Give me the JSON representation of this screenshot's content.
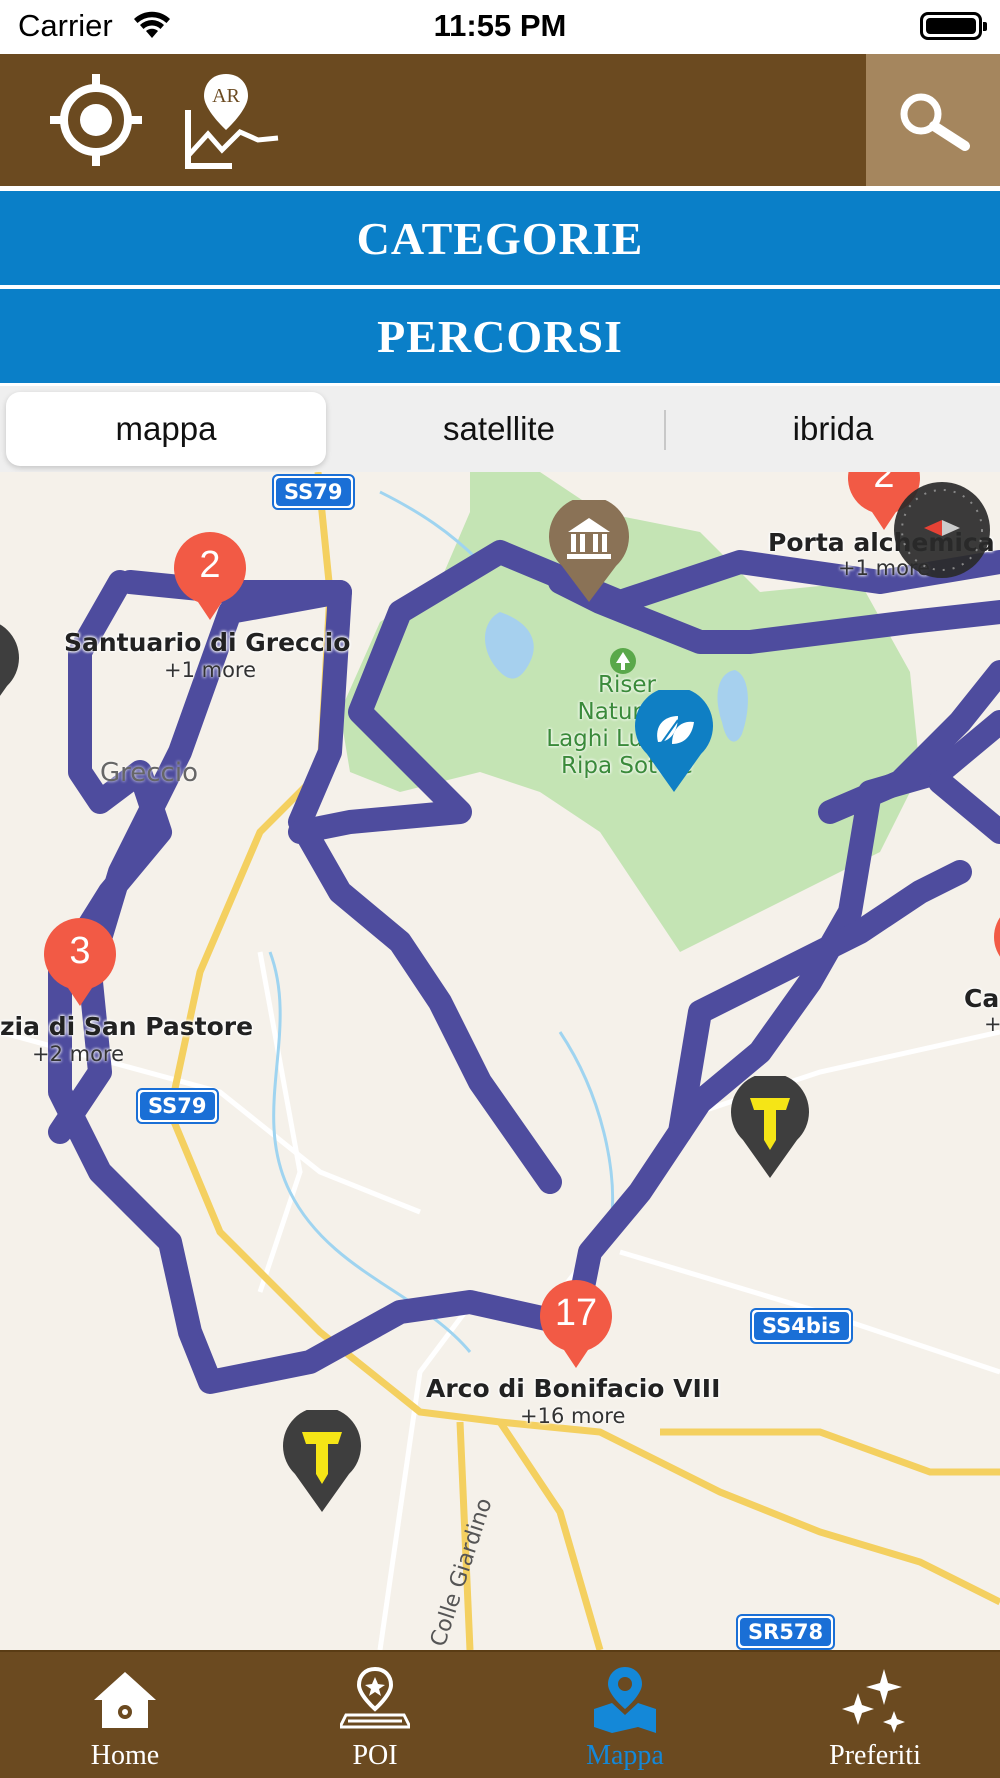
{
  "status_bar": {
    "carrier": "Carrier",
    "time": "11:55 PM"
  },
  "toolbar": {
    "ar_icon_text": "AR"
  },
  "header": {
    "categorie": "CATEGORIE",
    "percorsi": "PERCORSI"
  },
  "map_type": {
    "options": [
      "mappa",
      "satellite",
      "ibrida"
    ],
    "selected": "mappa"
  },
  "map": {
    "clusters": [
      {
        "count": "2",
        "title": "Santuario di Greccio",
        "more": "+1 more"
      },
      {
        "count": "3",
        "title": "zia di San Pastore",
        "more": "+2 more"
      },
      {
        "count": "17",
        "title": "Arco di Bonifacio VIII",
        "more": "+16 more"
      },
      {
        "count": "2",
        "title": "Porta alchemica",
        "more": "+1 more"
      }
    ],
    "park_label": "Riserva\nNaturale\nLaghi Lungo e\nRipa Sottile",
    "park_lines": [
      "Riser",
      "Naturale",
      "Laghi Lungo e",
      "Ripa Sottile"
    ],
    "town_label": "Greccio",
    "edge_label": "Ca",
    "edge_more": "+",
    "road_shields": [
      "SS79",
      "SS79",
      "SS4bis",
      "SR578"
    ],
    "road_name": "Colle Giardino",
    "route_color": "#4e4c9e",
    "cluster_color": "#f25a45"
  },
  "tabs": [
    {
      "label": "Home",
      "icon": "home-icon"
    },
    {
      "label": "POI",
      "icon": "poi-icon"
    },
    {
      "label": "Mappa",
      "icon": "map-icon",
      "active": true
    },
    {
      "label": "Preferiti",
      "icon": "sparkles-icon"
    }
  ]
}
